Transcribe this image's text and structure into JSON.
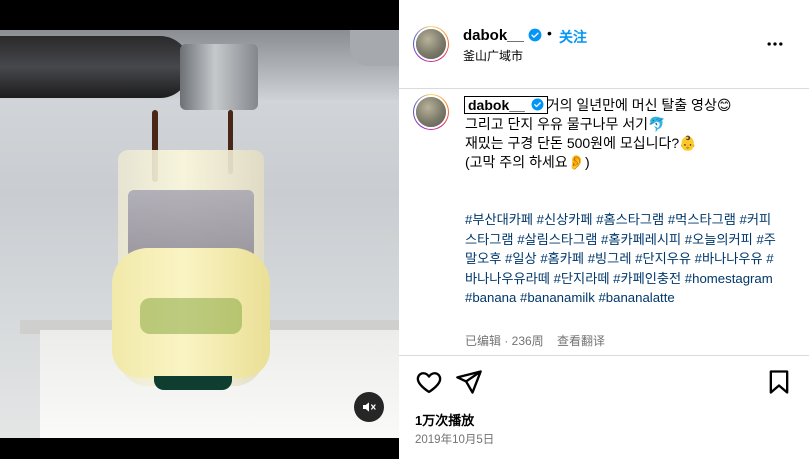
{
  "video": {
    "mute_icon": "speaker-muted-icon"
  },
  "header": {
    "username": "dabok__",
    "separator": "•",
    "follow_label": "关注",
    "location": "釜山广域市",
    "more_icon": "more-horizontal-icon"
  },
  "caption": {
    "username": "dabok__",
    "lines": [
      "거의 일년만에 머신 탈출 영상😊",
      "그리고 단지 우유 물구나무 서기🐬",
      "재밌는 구경 단돈 500원에 모십니다?👶",
      "(고막 주의 하세요👂)"
    ],
    "hashtags": "#부산대카페 #신상카페 #홈스타그램 #먹스타그램 #커피스타그램 #살림스타그램 #홈카페레시피 #오늘의커피 #주말오후 #일상 #홈카페 #빙그레 #단지우유 #바나나우유 #바나나우유라떼 #단지라떼 #카페인충전 #homestagram #banana #bananamilk #bananalatte",
    "edited": "已编辑 · 236周",
    "translate": "查看翻译"
  },
  "actions": {
    "like_icon": "heart-icon",
    "share_icon": "paper-plane-icon",
    "save_icon": "bookmark-icon"
  },
  "stats": {
    "plays": "1万次播放",
    "date": "2019年10月5日"
  },
  "colors": {
    "follow": "#0095f6",
    "hashtag": "#00376b",
    "muted_text": "#737373",
    "verified": "#0095f6"
  }
}
